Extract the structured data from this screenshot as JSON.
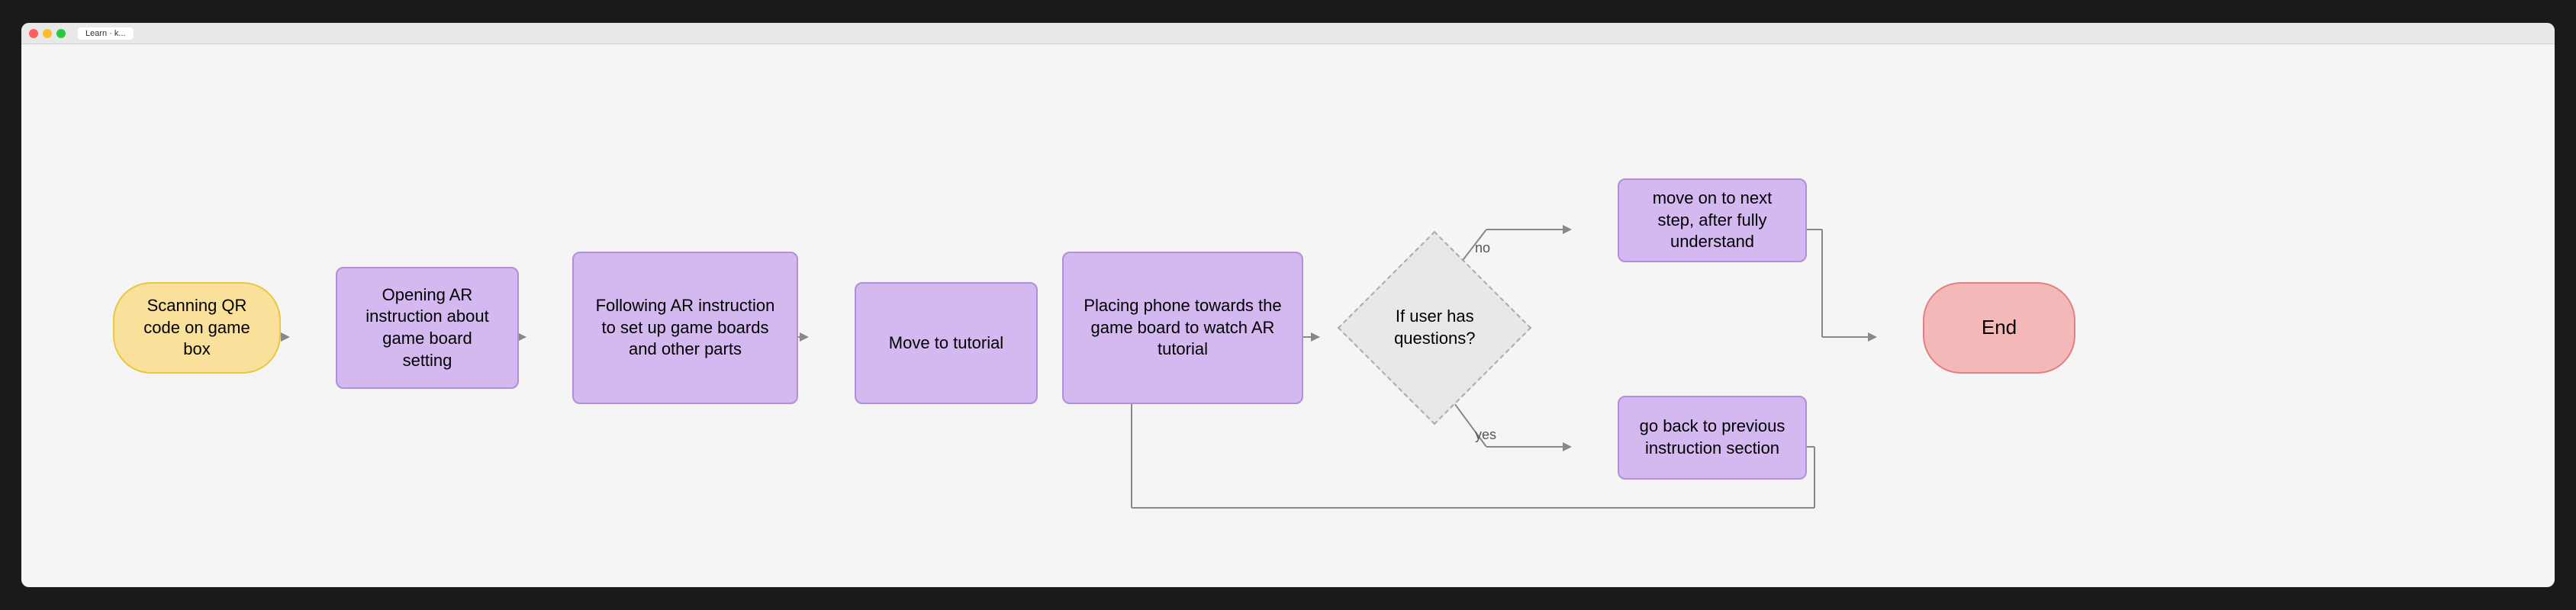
{
  "titlebar": {
    "tab_label": "Learn · k..."
  },
  "nodes": {
    "start": "Scanning QR code on game box",
    "step1": "Opening AR instruction about game board setting",
    "step2": "Following AR instruction to set up game boards and other parts",
    "step3": "Move to tutorial",
    "step4": "Placing phone towards the game board to watch AR tutorial",
    "diamond": "If user has questions?",
    "branch_no": "move on to next step, after fully understand",
    "branch_yes": "go back to previous instruction section",
    "end": "End"
  },
  "labels": {
    "no": "no",
    "yes": "yes"
  },
  "colors": {
    "yellow_bg": "#f9e09b",
    "yellow_border": "#e8c840",
    "purple_bg": "#d4b8f0",
    "purple_border": "#b090d8",
    "pink_bg": "#f5b8b8",
    "pink_border": "#e08080",
    "diamond_bg": "#e8e8e8",
    "arrow": "#888888"
  }
}
